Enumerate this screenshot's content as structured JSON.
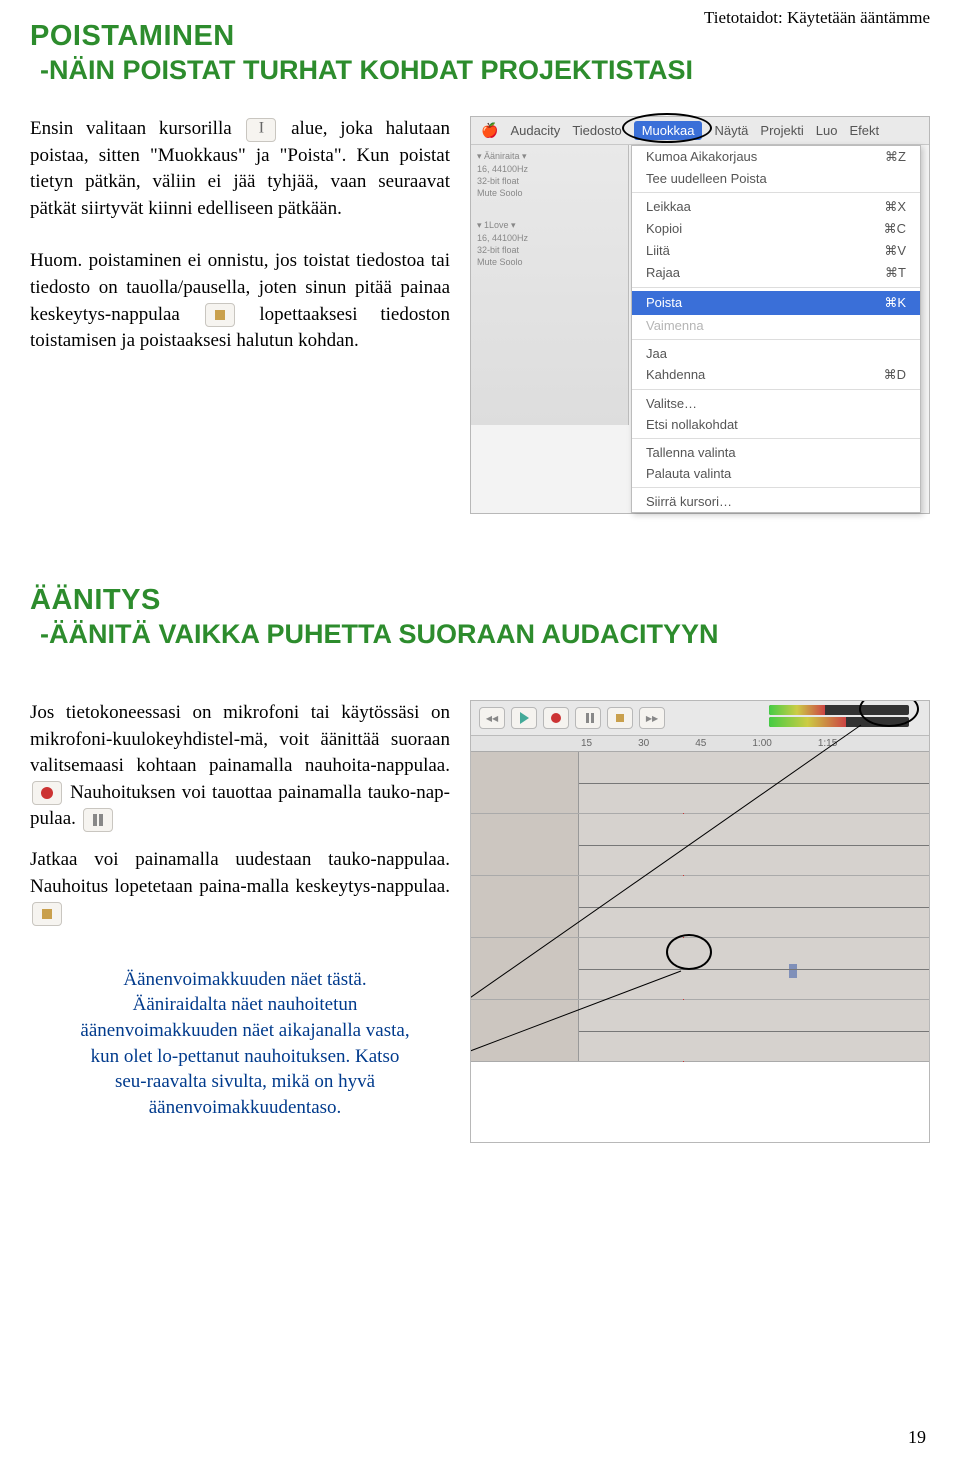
{
  "header_right": "Tietotaidot: Käytetään ääntämme",
  "section1": {
    "title": "POISTAMINEN",
    "subtitle": "-NÄIN POISTAT TURHAT KOHDAT PROJEKTISTASI",
    "p1a": "Ensin valitaan kursorilla",
    "p1b": "alue, joka halutaan poistaa, sitten \"Muokkaus\" ja \"Poista\". Kun poistat tietyn pätkän, väliin ei jää tyhjää, vaan seuraavat pätkät siirtyvät kiinni edelliseen pätkään.",
    "p2a": "Huom. poistaminen ei onnistu, jos toistat tiedostoa tai tiedosto on tauolla/pausella, joten sinun pitää painaa keskeytys-nappulaa",
    "p2b": "lopettaaksesi tiedoston toistamisen ja poistaaksesi halutun kohdan."
  },
  "menu": {
    "app": "Audacity",
    "items": [
      "Tiedosto",
      "Muokkaa",
      "Näytä",
      "Projekti",
      "Luo",
      "Efekt"
    ],
    "selected": "Muokkaa",
    "dropdown": [
      {
        "label": "Kumoa Aikakorjaus",
        "shortcut": "⌘Z"
      },
      {
        "label": "Tee uudelleen Poista",
        "shortcut": ""
      },
      {
        "sep": true
      },
      {
        "label": "Leikkaa",
        "shortcut": "⌘X"
      },
      {
        "label": "Kopioi",
        "shortcut": "⌘C"
      },
      {
        "label": "Liitä",
        "shortcut": "⌘V"
      },
      {
        "label": "Rajaa",
        "shortcut": "⌘T"
      },
      {
        "sep": true
      },
      {
        "label": "Poista",
        "shortcut": "⌘K",
        "selected": true
      },
      {
        "label": "Vaimenna",
        "shortcut": "",
        "disabled": true
      },
      {
        "sep": true
      },
      {
        "label": "Jaa",
        "shortcut": ""
      },
      {
        "label": "Kahdenna",
        "shortcut": "⌘D"
      },
      {
        "sep": true
      },
      {
        "label": "Valitse…",
        "shortcut": ""
      },
      {
        "label": "Etsi nollakohdat",
        "shortcut": ""
      },
      {
        "sep": true
      },
      {
        "label": "Tallenna valinta",
        "shortcut": ""
      },
      {
        "label": "Palauta valinta",
        "shortcut": ""
      },
      {
        "sep": true
      },
      {
        "label": "Siirrä kursori…",
        "shortcut": ""
      }
    ]
  },
  "section2": {
    "title": "ÄÄNITYS",
    "subtitle": "-ÄÄNITÄ VAIKKA PUHETTA SUORAAN AUDACITYYN",
    "p1a": "Jos tietokoneessasi on mikrofoni tai käytössäsi on mikrofoni-kuulokeyhdistel-mä, voit äänittää suoraan valitsemaasi kohtaan painamalla nauhoita-nappulaa.",
    "p1b": "Nauhoituksen voi tauottaa painamalla tauko-nap-pulaa.",
    "p2": "Jatkaa voi painamalla uudestaan tauko-nappulaa. Nauhoitus lopetetaan paina-malla keskeytys-nappulaa.",
    "bubble": "Äänenvoimakkuuden näet tästä. Ääniraidalta näet nauhoitetun äänenvoimakkuuden näet aikajanalla vasta, kun olet lo-pettanut nauhoituksen. Katso seu-raavalta sivulta, mikä on hyvä äänenvoimakkuudentaso."
  },
  "ruler": [
    "15",
    "30",
    "45",
    "1:00",
    "1:15"
  ],
  "page_num": "19"
}
